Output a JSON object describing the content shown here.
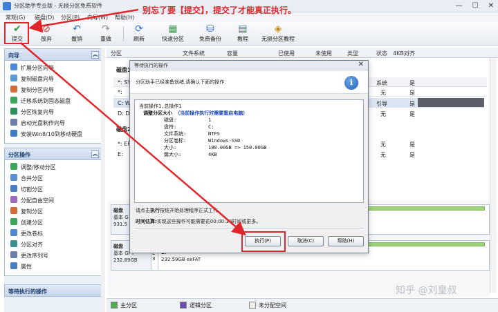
{
  "window": {
    "title": "分区助手专业版 - 无损分区免费软件"
  },
  "annotation": "别忘了要【提交】，提交了才能真正执行。",
  "menu": [
    "常规(G)",
    "磁盘(D)",
    "分区(P)",
    "向导(W)",
    "帮助(H)"
  ],
  "toolbar": {
    "buttons": [
      {
        "label": "提交",
        "icon": "checkmark-icon",
        "color": "#2e9c3a"
      },
      {
        "label": "放弃",
        "icon": "discard-icon",
        "color": "#c23a3a"
      },
      {
        "label": "撤销",
        "icon": "undo-icon",
        "color": "#2d6fc9"
      },
      {
        "label": "重做",
        "icon": "redo-icon",
        "color": "#8a8a8a"
      },
      {
        "label": "刷新",
        "icon": "refresh-icon",
        "color": "#2d6fc9"
      },
      {
        "label": "快速分区",
        "icon": "quick-partition-icon",
        "color": "#3a9a4a"
      },
      {
        "label": "免费备份",
        "icon": "backup-icon",
        "color": "#2d6fc9"
      },
      {
        "label": "教程",
        "icon": "tutorial-icon",
        "color": "#3a6fb5"
      },
      {
        "label": "无损分区教程",
        "icon": "lossless-tutorial-icon",
        "color": "#c48a1e"
      }
    ]
  },
  "sidebar": {
    "wizard_title": "向导",
    "wizard_items": [
      "扩展分区向导",
      "复制磁盘向导",
      "复制分区向导",
      "迁移系统到固态磁盘",
      "分区恢复向导",
      "启动光盘制作向导",
      "安装Win8/10到移动硬盘"
    ],
    "partition_title": "分区操作",
    "partition_items": [
      "调整/移动分区",
      "合并分区",
      "切割分区",
      "分配自由空间",
      "复制分区",
      "创建分区",
      "更改卷标",
      "分区对齐",
      "更改序列号",
      "属性"
    ],
    "pending_title": "等待执行的操作"
  },
  "table": {
    "headers": [
      "分区",
      "文件系统",
      "容量",
      "已使用",
      "未使用",
      "类型",
      "状态",
      "4KB对齐"
    ],
    "disk_labels": [
      "磁盘1",
      "磁盘2"
    ],
    "rows": [
      {
        "name": "*: SYS",
        "status": "系统",
        "align": "是"
      },
      {
        "name": "*:",
        "status": "无",
        "align": "是"
      },
      {
        "name": "C: Wi",
        "status": "引导",
        "align": "是"
      },
      {
        "name": "D: Da",
        "status": "无",
        "align": "是"
      },
      {
        "name": "*: EFI",
        "status": "无",
        "align": "是"
      },
      {
        "name": "E:",
        "status": "无",
        "align": "是"
      }
    ]
  },
  "disks": [
    {
      "title": "磁盘",
      "type": "基本 G",
      "size": "931.5",
      "num": "",
      "pname": "",
      "pinfo": ""
    },
    {
      "title": "磁盘",
      "type": "基本 GPT",
      "size": "232.89GB",
      "num": "3",
      "pname": "E:",
      "pinfo": "232.59GB exFAT",
      "num_top": "E"
    }
  ],
  "legend": [
    "主分区",
    "逻辑分区",
    "未分配空间"
  ],
  "legend_colors": [
    "#4cae4c",
    "#6b4fb3",
    "#f0efe6"
  ],
  "dialog": {
    "title": "等待执行的操作",
    "message": "分区助手已经准备就绪,请确认下面的操作.",
    "summary": "当前操作1,总操作1",
    "op_title": "调整分区大小",
    "op_note": "（当前操作执行时需要重启电脑）",
    "details": [
      {
        "k": "磁盘:",
        "v": "1"
      },
      {
        "k": "盘符:",
        "v": "C:"
      },
      {
        "k": "文件系统:",
        "v": "NTFS"
      },
      {
        "k": "分区卷标:",
        "v": "Windows-SSD"
      },
      {
        "k": "大小:",
        "v": "100.00GB => 150.00GB"
      },
      {
        "k": "簇大小:",
        "v": "4KB"
      }
    ],
    "hint_pre": "请点击",
    "hint_bold": "执行",
    "hint_post": "按钮开始处理程序正式工作。",
    "time_label": "时间估算:",
    "time_text": "实现这些操作可能需要花00:00:30时间或更多。",
    "buttons": {
      "execute": "执行(P)",
      "cancel": "取消(C)",
      "help": "帮助(H)"
    }
  },
  "watermark": "知乎 @刘皇叔"
}
